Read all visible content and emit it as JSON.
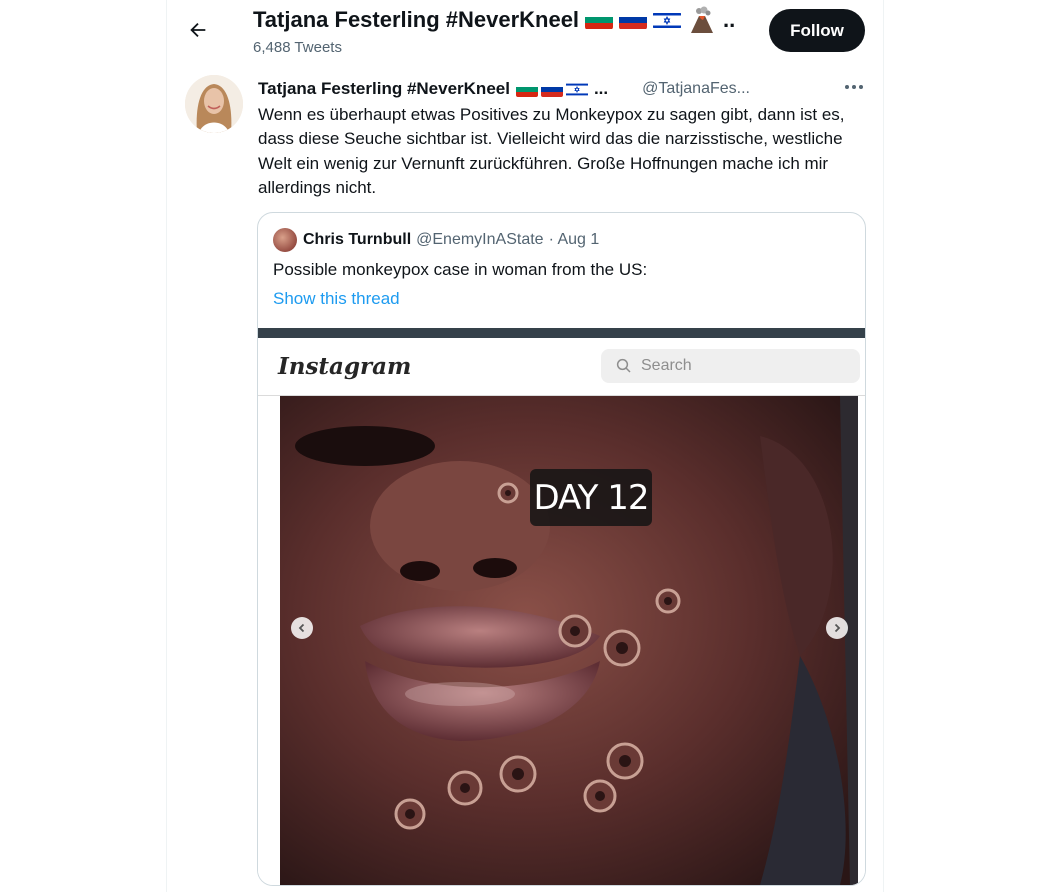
{
  "header": {
    "title": "Tatjana Festerling #NeverKneel",
    "tweet_count": "6,488 Tweets",
    "follow_label": "Follow"
  },
  "tweet": {
    "author_name": "Tatjana Festerling #NeverKneel",
    "author_ellipsis": "...",
    "author_handle": "@TatjanaFes...",
    "text": "Wenn es überhaupt etwas Positives zu Monkeypox zu sagen gibt, dann ist es, dass diese Seuche sichtbar ist. Vielleicht wird das die narzisstische, westliche Welt ein wenig zur Vernunft zurückführen. Große Hoffnungen mache ich mir allerdings nicht."
  },
  "quote": {
    "author_name": "Chris Turnbull",
    "author_handle": "@EnemyInAState",
    "date": "· Aug 1",
    "text": "Possible monkeypox case in woman from the US:",
    "show_thread": "Show this thread",
    "media": {
      "brand": "Instagram",
      "search_placeholder": "Search",
      "badge": "DAY 12"
    }
  },
  "icons": [
    "back-arrow-icon",
    "bulgaria-flag-icon",
    "russia-flag-icon",
    "israel-flag-icon",
    "volcano-icon",
    "more-icon",
    "search-icon",
    "chevron-left-icon",
    "chevron-right-icon"
  ],
  "colors": {
    "link": "#1d9bf0",
    "button_bg": "#0f1419",
    "muted": "#536471"
  }
}
